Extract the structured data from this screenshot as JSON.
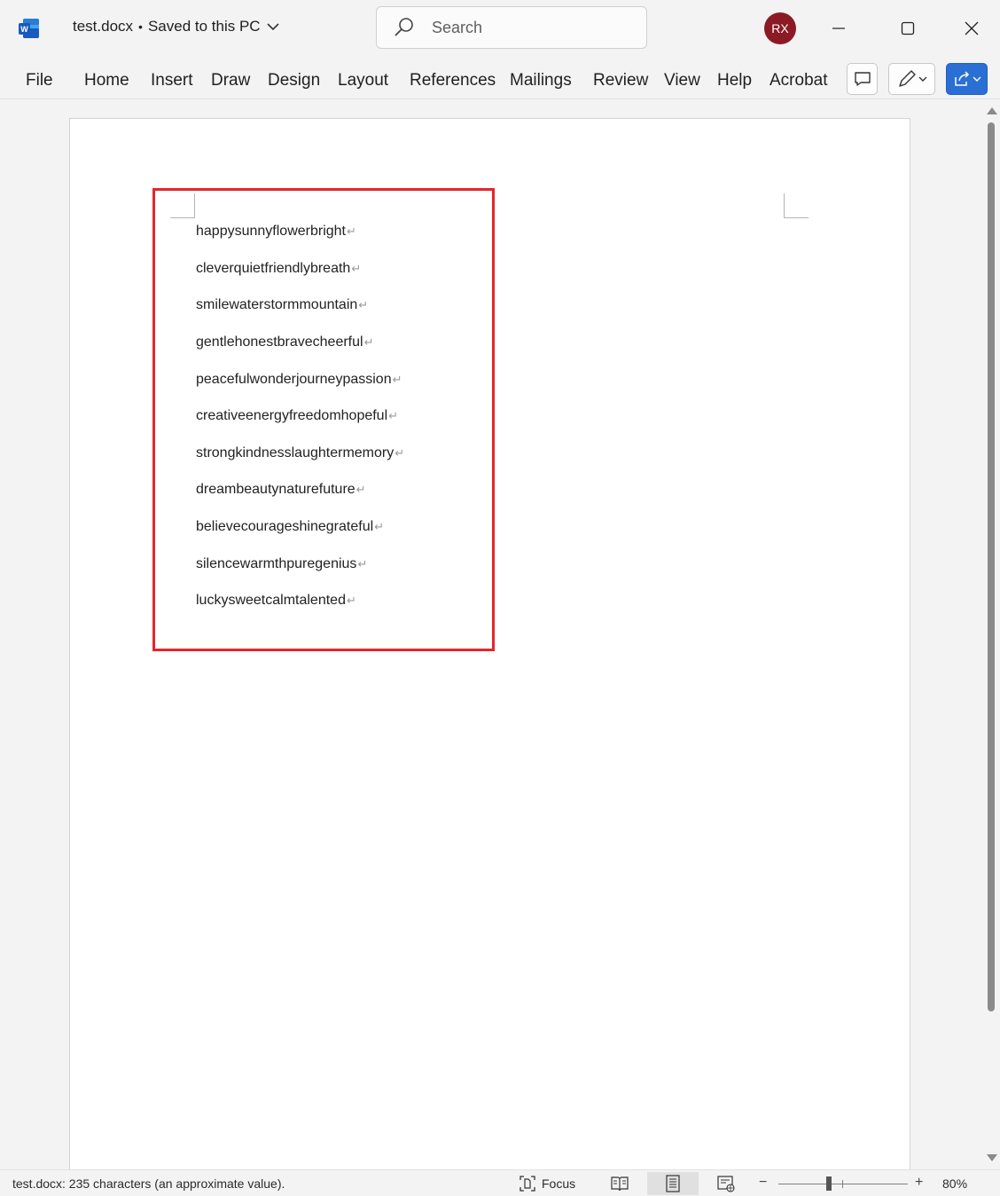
{
  "titlebar": {
    "doc_name": "test.docx",
    "separator": "•",
    "save_status": "Saved to this PC",
    "search_placeholder": "Search",
    "avatar_initials": "RX"
  },
  "ribbon": {
    "tabs": [
      "File",
      "Home",
      "Insert",
      "Draw",
      "Design",
      "Layout",
      "References",
      "Mailings",
      "Review",
      "View",
      "Help",
      "Acrobat"
    ]
  },
  "document": {
    "paragraphs": [
      "happysunnyflowerbright",
      "cleverquietfriendlybreath",
      "smilewaterstormmountain",
      "gentlehonestbravecheerful",
      "peacefulwonderjourneypassion",
      "creativeenergyfreedomhopeful",
      "strongkindnesslaughtermemory",
      "dreambeautynaturefuture",
      "believecourageshinegrateful",
      "silencewarmthpuregenius",
      "luckysweetcalmtalented"
    ],
    "paragraph_mark": "↵"
  },
  "statusbar": {
    "text": "test.docx: 235 characters (an approximate value).",
    "focus_label": "Focus",
    "zoom_minus": "−",
    "zoom_plus": "+",
    "zoom_level": "80%"
  },
  "colors": {
    "highlight_border": "#e3262c",
    "avatar_bg": "#8b1a24",
    "share_button": "#2a6fd4",
    "word_brand": "#185abd"
  },
  "icons": [
    "word-logo-icon",
    "chevron-down-icon",
    "search-icon",
    "minimize-icon",
    "maximize-icon",
    "close-icon",
    "comment-icon",
    "pen-icon",
    "share-icon",
    "focus-icon",
    "read-mode-icon",
    "print-layout-icon",
    "web-layout-icon"
  ]
}
